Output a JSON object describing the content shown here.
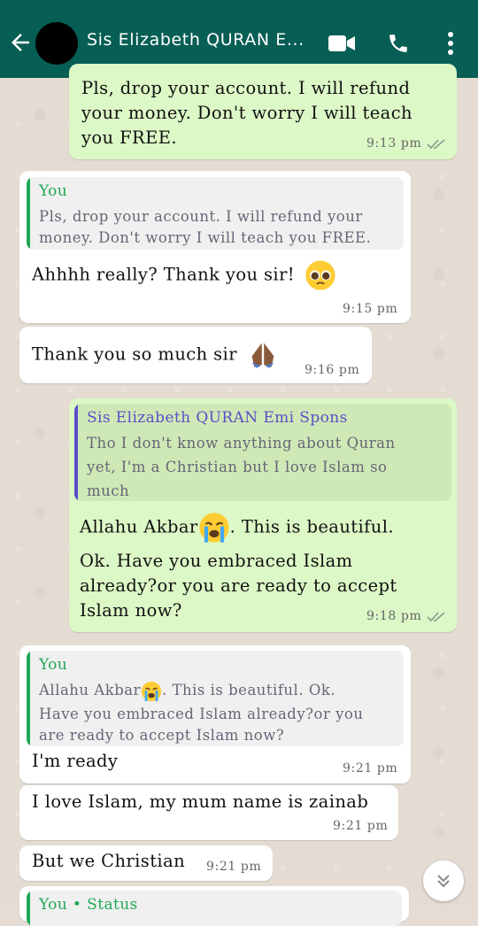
{
  "header": {
    "contact_name": "Sis Elizabeth QURAN E..."
  },
  "colors": {
    "header": "#075e54",
    "outgoing_bubble": "#dcf8c6",
    "incoming_bubble": "#ffffff",
    "you_quote": "#1fa855",
    "contact_quote": "#5a4fc7"
  },
  "messages": [
    {
      "direction": "out",
      "text_lines": [
        "Pls, drop your account. I will refund",
        "your money. Don't worry I will teach",
        "you FREE."
      ],
      "time": "9:13 pm",
      "status": "read"
    },
    {
      "direction": "in",
      "quote": {
        "author": "You",
        "lines": [
          "Pls, drop your account. I will refund your",
          "money. Don't worry I will teach you FREE."
        ]
      },
      "text": "Ahhhh really? Thank you sir!",
      "emoji": "pleading-face",
      "time": "9:15 pm"
    },
    {
      "direction": "in",
      "text": "Thank you so much sir",
      "emoji": "folded-hands",
      "time": "9:16 pm"
    },
    {
      "direction": "out",
      "quote": {
        "author": "Sis Elizabeth QURAN Emi Spons",
        "lines": [
          "Tho I don't know anything about Quran",
          "yet, I'm a Christian but I love Islam so",
          "much"
        ]
      },
      "text_a_pre": "Allahu Akbar",
      "emoji": "crying-face",
      "text_a_post": ". This is beautiful.",
      "text_b_lines": [
        "Ok. Have you embraced Islam",
        "already?or you are ready to accept",
        "Islam now?"
      ],
      "time": "9:18 pm",
      "status": "read"
    },
    {
      "direction": "in",
      "quote": {
        "author": "You",
        "line1_pre": "Allahu Akbar",
        "line1_post": ". This is beautiful. Ok.",
        "lines": [
          "Have you embraced Islam already?or you",
          "are ready to accept Islam now?"
        ]
      },
      "text": "I'm ready",
      "time": "9:21 pm"
    },
    {
      "direction": "in",
      "text": "I love Islam, my mum name is zainab",
      "time": "9:21 pm"
    },
    {
      "direction": "in",
      "text": "But we Christian",
      "time": "9:21 pm"
    },
    {
      "direction": "in",
      "quote": {
        "author": "You • Status"
      }
    }
  ]
}
